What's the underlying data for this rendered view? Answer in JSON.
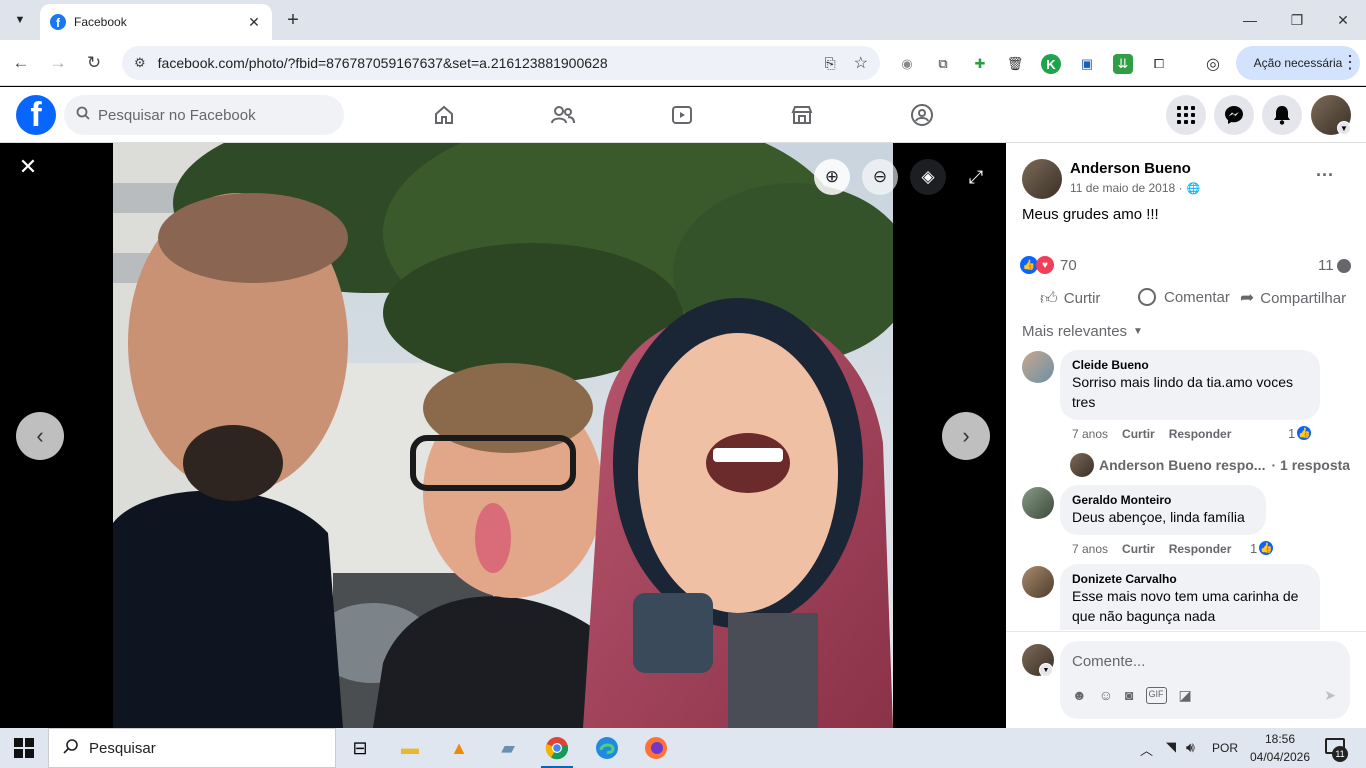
{
  "browser": {
    "tab_title": "Facebook",
    "url": "facebook.com/photo/?fbid=876787059167637&set=a.216123881900628",
    "action_label": "Ação necessária"
  },
  "fb": {
    "search_placeholder": "Pesquisar no Facebook"
  },
  "post": {
    "author": "Anderson Bueno",
    "date": "11 de maio de 2018 ·",
    "caption": "Meus grudes amo !!!",
    "reactions_count": "70",
    "comments_count": "11",
    "like_label": "Curtir",
    "comment_label": "Comentar",
    "share_label": "Compartilhar",
    "sort_label": "Mais relevantes"
  },
  "comments": [
    {
      "name": "Cleide Bueno",
      "text": "Sorriso mais lindo da tia.amo voces tres",
      "age": "7 anos",
      "like": "Curtir",
      "reply": "Responder",
      "reactions": "1"
    },
    {
      "name": "Geraldo Monteiro",
      "text": "Deus abençoe, linda família",
      "age": "7 anos",
      "like": "Curtir",
      "reply": "Responder",
      "reactions": "1"
    },
    {
      "name": "Donizete Carvalho",
      "text": "Esse mais novo tem uma carinha de que não bagunça nada"
    }
  ],
  "reply_summary": {
    "text": "Anderson Bueno respo...",
    "count": "· 1 resposta"
  },
  "composer": {
    "placeholder": "Comente..."
  },
  "taskbar": {
    "search_label": "Pesquisar",
    "lang": "POR",
    "time": "18:56",
    "date": "04/04/2026",
    "notif_count": "11"
  }
}
